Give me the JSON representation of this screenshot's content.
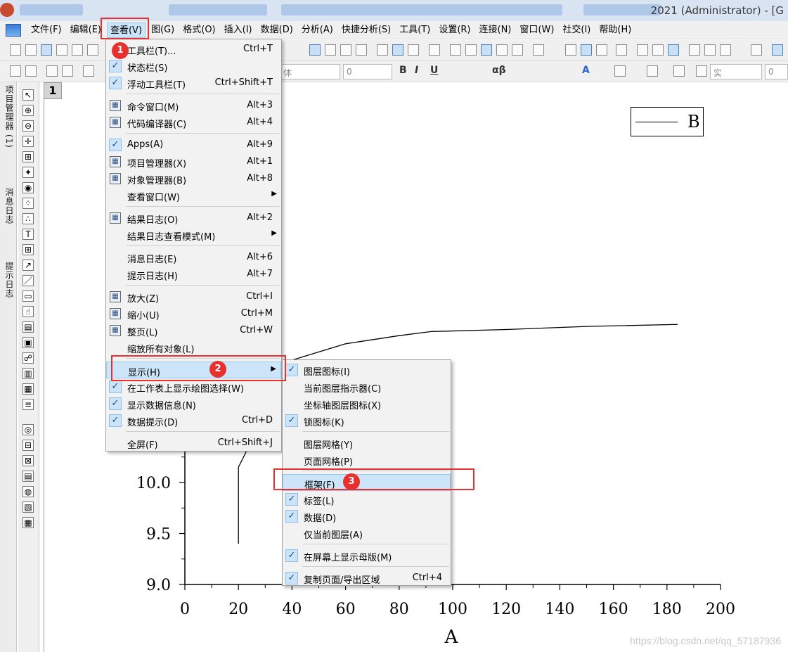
{
  "window": {
    "title": "2021 (Administrator) - [G"
  },
  "menubar": {
    "items": [
      "文件(F)",
      "编辑(E)",
      "查看(V)",
      "图(G)",
      "格式(O)",
      "插入(I)",
      "数据(D)",
      "分析(A)",
      "快捷分析(S)",
      "工具(T)",
      "设置(R)",
      "连接(N)",
      "窗口(W)",
      "社交(I)",
      "帮助(H)"
    ],
    "active": "查看(V)"
  },
  "toolbar2": {
    "font_combo": "体",
    "size_combo": "0",
    "line_style": "实",
    "line_width": "0"
  },
  "left_dock": {
    "tabs": [
      "项目管理器 (1)",
      "消息日志",
      "提示日志"
    ]
  },
  "graph": {
    "page_number": "1",
    "legend": {
      "label": "B"
    },
    "x_axis_title": "A",
    "color_line": "#000000"
  },
  "chart_data": {
    "type": "line",
    "title": "",
    "xlabel": "A",
    "ylabel": "",
    "xlim": [
      0,
      200
    ],
    "ylim": [
      9.0,
      12.0
    ],
    "x_ticks": [
      0,
      20,
      40,
      60,
      80,
      100,
      120,
      140,
      160,
      180,
      200
    ],
    "y_ticks_visible": [
      "9.0",
      "9.5",
      "10.0"
    ],
    "series": [
      {
        "name": "B",
        "x": [
          20,
          20,
          40,
          60,
          80,
          92,
          120,
          150,
          184
        ],
        "y": [
          9.4,
          10.15,
          11.2,
          11.36,
          11.44,
          11.48,
          11.5,
          11.53,
          11.55
        ]
      }
    ]
  },
  "view_menu": {
    "items": [
      {
        "label": "工具栏(T)...",
        "shortcut": "Ctrl+T",
        "checked": false,
        "icon": "",
        "submenu": false
      },
      {
        "label": "状态栏(S)",
        "shortcut": "",
        "checked": true,
        "icon": "",
        "submenu": false
      },
      {
        "label": "浮动工具栏(T)",
        "shortcut": "Ctrl+Shift+T",
        "checked": true,
        "icon": "",
        "submenu": false
      },
      {
        "separator": true
      },
      {
        "label": "命令窗口(M)",
        "shortcut": "Alt+3",
        "checked": false,
        "icon": "command-window-icon",
        "submenu": false
      },
      {
        "label": "代码编译器(C)",
        "shortcut": "Alt+4",
        "checked": false,
        "icon": "code-builder-icon",
        "submenu": false
      },
      {
        "separator": true
      },
      {
        "label": "Apps(A)",
        "shortcut": "Alt+9",
        "checked": true,
        "icon": "",
        "submenu": false
      },
      {
        "label": "项目管理器(X)",
        "shortcut": "Alt+1",
        "checked": false,
        "icon": "project-explorer-icon",
        "submenu": false
      },
      {
        "label": "对象管理器(B)",
        "shortcut": "Alt+8",
        "checked": false,
        "icon": "object-manager-icon",
        "submenu": false
      },
      {
        "label": "查看窗口(W)",
        "shortcut": "",
        "checked": false,
        "icon": "",
        "submenu": true
      },
      {
        "separator": true
      },
      {
        "label": "结果日志(O)",
        "shortcut": "Alt+2",
        "checked": false,
        "icon": "results-log-icon",
        "submenu": false
      },
      {
        "label": "结果日志查看模式(M)",
        "shortcut": "",
        "checked": false,
        "icon": "",
        "submenu": true
      },
      {
        "separator": true
      },
      {
        "label": "消息日志(E)",
        "shortcut": "Alt+6",
        "checked": false,
        "icon": "",
        "submenu": false
      },
      {
        "label": "提示日志(H)",
        "shortcut": "Alt+7",
        "checked": false,
        "icon": "",
        "submenu": false
      },
      {
        "separator": true
      },
      {
        "label": "放大(Z)",
        "shortcut": "Ctrl+I",
        "checked": false,
        "icon": "zoom-in-icon",
        "submenu": false
      },
      {
        "label": "缩小(U)",
        "shortcut": "Ctrl+M",
        "checked": false,
        "icon": "zoom-out-icon",
        "submenu": false
      },
      {
        "label": "整页(L)",
        "shortcut": "Ctrl+W",
        "checked": false,
        "icon": "whole-page-icon",
        "submenu": false
      },
      {
        "label": "缩放所有对象(L)",
        "shortcut": "",
        "checked": false,
        "icon": "",
        "submenu": false
      },
      {
        "separator": true
      },
      {
        "label": "显示(H)",
        "shortcut": "",
        "checked": false,
        "icon": "",
        "submenu": true,
        "highlighted": true
      },
      {
        "label": "在工作表上显示绘图选择(W)",
        "shortcut": "",
        "checked": true,
        "icon": "",
        "submenu": false
      },
      {
        "label": "显示数据信息(N)",
        "shortcut": "",
        "checked": true,
        "icon": "",
        "submenu": false
      },
      {
        "label": "数据提示(D)",
        "shortcut": "Ctrl+D",
        "checked": true,
        "icon": "",
        "submenu": false
      },
      {
        "separator": true
      },
      {
        "label": "全屏(F)",
        "shortcut": "Ctrl+Shift+J",
        "checked": false,
        "icon": "",
        "submenu": false
      }
    ]
  },
  "show_submenu": {
    "items": [
      {
        "label": "图层图标(I)",
        "shortcut": "",
        "checked": true
      },
      {
        "label": "当前图层指示器(C)",
        "shortcut": "",
        "checked": false
      },
      {
        "label": "坐标轴图层图标(X)",
        "shortcut": "",
        "checked": false
      },
      {
        "label": "锁图标(K)",
        "shortcut": "",
        "checked": true
      },
      {
        "separator": true
      },
      {
        "label": "图层网格(Y)",
        "shortcut": "",
        "checked": false
      },
      {
        "label": "页面网格(P)",
        "shortcut": "",
        "checked": false
      },
      {
        "separator": true
      },
      {
        "label": "框架(F)",
        "shortcut": "",
        "checked": false,
        "highlighted": true
      },
      {
        "label": "标签(L)",
        "shortcut": "",
        "checked": true
      },
      {
        "label": "数据(D)",
        "shortcut": "",
        "checked": true
      },
      {
        "label": "仅当前图层(A)",
        "shortcut": "",
        "checked": false
      },
      {
        "separator": true
      },
      {
        "label": "在屏幕上显示母版(M)",
        "shortcut": "",
        "checked": true
      },
      {
        "separator": true
      },
      {
        "label": "复制页面/导出区域",
        "shortcut": "Ctrl+4",
        "checked": true
      }
    ]
  },
  "annotations": {
    "badges": [
      "1",
      "2",
      "3"
    ],
    "color": "#e8302f"
  },
  "watermark": "https://blog.csdn.net/qq_57187936"
}
